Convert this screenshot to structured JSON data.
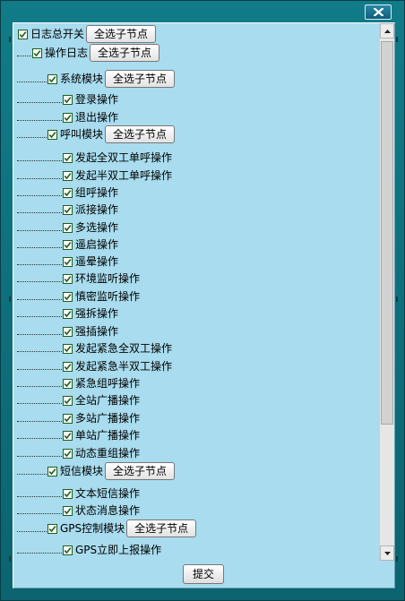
{
  "window": {
    "close_label": "✕"
  },
  "tree": {
    "select_children_label": "全选子节点",
    "rows": [
      {
        "label": "日志总开关",
        "level": 0,
        "has_button": true
      },
      {
        "label": "操作日志",
        "level": 1,
        "has_button": true
      },
      {
        "label": "系统模块",
        "level": 2,
        "has_button": true
      },
      {
        "label": "登录操作",
        "level": 3,
        "has_button": false
      },
      {
        "label": "退出操作",
        "level": 3,
        "has_button": false
      },
      {
        "label": "呼叫模块",
        "level": 2,
        "has_button": true
      },
      {
        "label": "发起全双工单呼操作",
        "level": 3,
        "has_button": false
      },
      {
        "label": "发起半双工单呼操作",
        "level": 3,
        "has_button": false
      },
      {
        "label": "组呼操作",
        "level": 3,
        "has_button": false
      },
      {
        "label": "派接操作",
        "level": 3,
        "has_button": false
      },
      {
        "label": "多选操作",
        "level": 3,
        "has_button": false
      },
      {
        "label": "遥启操作",
        "level": 3,
        "has_button": false
      },
      {
        "label": "遥晕操作",
        "level": 3,
        "has_button": false
      },
      {
        "label": "环境监听操作",
        "level": 3,
        "has_button": false
      },
      {
        "label": "慎密监听操作",
        "level": 3,
        "has_button": false
      },
      {
        "label": "强拆操作",
        "level": 3,
        "has_button": false
      },
      {
        "label": "强插操作",
        "level": 3,
        "has_button": false
      },
      {
        "label": "发起紧急全双工操作",
        "level": 3,
        "has_button": false
      },
      {
        "label": "发起紧急半双工操作",
        "level": 3,
        "has_button": false
      },
      {
        "label": "紧急组呼操作",
        "level": 3,
        "has_button": false
      },
      {
        "label": "全站广播操作",
        "level": 3,
        "has_button": false
      },
      {
        "label": "多站广播操作",
        "level": 3,
        "has_button": false
      },
      {
        "label": "单站广播操作",
        "level": 3,
        "has_button": false
      },
      {
        "label": "动态重组操作",
        "level": 3,
        "has_button": false
      },
      {
        "label": "短信模块",
        "level": 2,
        "has_button": true
      },
      {
        "label": "文本短信操作",
        "level": 3,
        "has_button": false
      },
      {
        "label": "状态消息操作",
        "level": 3,
        "has_button": false
      },
      {
        "label": "GPS控制模块",
        "level": 2,
        "has_button": true
      },
      {
        "label": "GPS立即上报操作",
        "level": 3,
        "has_button": false
      }
    ]
  },
  "footer": {
    "submit_label": "提交"
  },
  "colors": {
    "panel_bg": "#a8dcee",
    "frame": "#0b6b78",
    "check": "#1c5e1c"
  }
}
